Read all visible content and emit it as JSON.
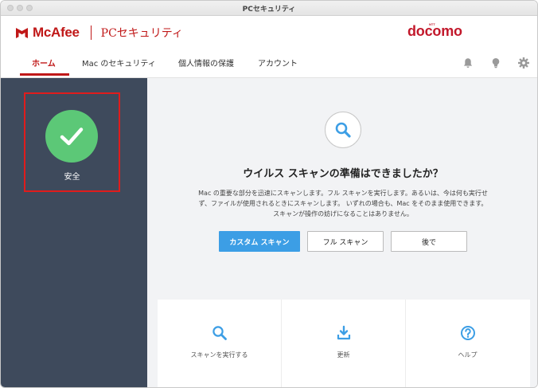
{
  "window": {
    "title": "PCセキュリティ"
  },
  "header": {
    "brand": "McAfee",
    "product": "PCセキュリティ",
    "carrier": "docomo",
    "carrier_mark": "NTT"
  },
  "nav": {
    "tabs": [
      {
        "label": "ホーム",
        "active": true
      },
      {
        "label": "Mac のセキュリティ",
        "active": false
      },
      {
        "label": "個人情報の保護",
        "active": false
      },
      {
        "label": "アカウント",
        "active": false
      }
    ],
    "icons": [
      "bell-icon",
      "lightbulb-icon",
      "gear-icon"
    ]
  },
  "sidebar": {
    "status_label": "安全",
    "status_icon": "checkmark-icon"
  },
  "main": {
    "headline": "ウイルス スキャンの準備はできましたか？",
    "description_lines": [
      "Mac の重要な部分を迅速にスキャンします。フル スキャンを実行します。あるいは、今は何も実行せ",
      "ず、ファイルが使用されるときにスキャンします。 いずれの場合も、Mac をそのまま使用できます。",
      "スキャンが操作の妨げになることはありません。"
    ],
    "buttons": {
      "custom_scan": "カスタム スキャン",
      "full_scan": "フル スキャン",
      "later": "後で"
    }
  },
  "cards": [
    {
      "label": "スキャンを実行する",
      "icon": "search-icon"
    },
    {
      "label": "更新",
      "icon": "download-icon"
    },
    {
      "label": "ヘルプ",
      "icon": "help-icon"
    }
  ],
  "colors": {
    "accent_red": "#c01818",
    "safe_green": "#5cc877",
    "primary_blue": "#3c9ee5",
    "sidebar_bg": "#3e4a5c",
    "highlight_box": "#e01c1c"
  }
}
